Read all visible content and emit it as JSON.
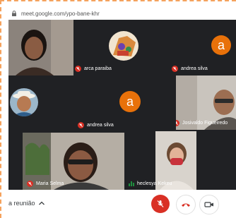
{
  "browser": {
    "url": "meet.google.com/ypo-bane-khr"
  },
  "participants": {
    "p1": {
      "name": ""
    },
    "p2": {
      "name": "arca paraiba"
    },
    "p3": {
      "name": "andrea silva",
      "initial": "a"
    },
    "p4": {
      "name": ""
    },
    "p5": {
      "name": "andrea silva",
      "initial": "a"
    },
    "p6": {
      "name": "Josivaldo Figueiredo"
    },
    "p7": {
      "name": "Maria Selma"
    },
    "p8": {
      "name": "heclesya Kekeu"
    }
  },
  "controls": {
    "meeting_label": "a reunião"
  },
  "colors": {
    "end_call": "#d93025",
    "avatar": "#e8710a",
    "background": "#202124"
  }
}
